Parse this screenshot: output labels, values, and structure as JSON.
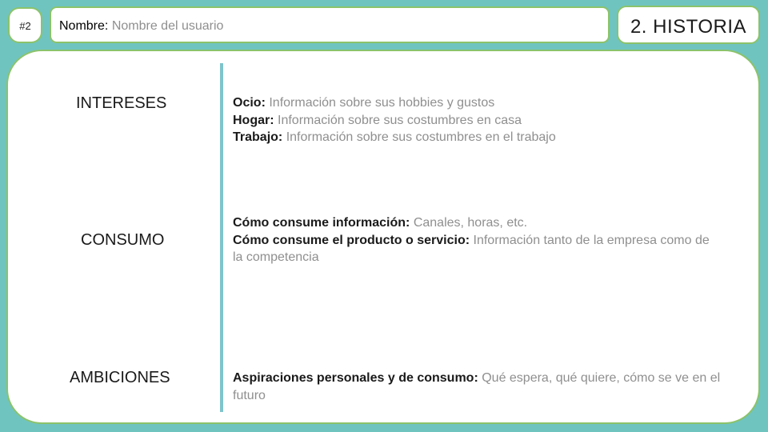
{
  "slide_number": "#2",
  "name_field": {
    "label": "Nombre:",
    "value": "Nombre del usuario"
  },
  "section_title": "2. HISTORIA",
  "rows": [
    {
      "label": "INTERESES",
      "lines": [
        {
          "key": "Ocio:",
          "value": "Información sobre sus hobbies y gustos"
        },
        {
          "key": "Hogar:",
          "value": "Información sobre sus costumbres en casa"
        },
        {
          "key": "Trabajo:",
          "value": "Información sobre sus costumbres en el trabajo"
        }
      ]
    },
    {
      "label": "CONSUMO",
      "lines": [
        {
          "key": "Cómo consume información:",
          "value": "Canales, horas, etc."
        },
        {
          "key": "Cómo consume el producto o servicio:",
          "value": "Información tanto de la empresa como de la competencia"
        }
      ]
    },
    {
      "label": "AMBICIONES",
      "lines": [
        {
          "key": "Aspiraciones personales y de consumo:",
          "value": "Qué espera, qué quiere, cómo se ve en el futuro"
        }
      ]
    }
  ],
  "colors": {
    "background": "#6fc4c0",
    "border": "#8cc36a",
    "divider": "#7fc4cc",
    "muted_text": "#8f8f8f"
  }
}
